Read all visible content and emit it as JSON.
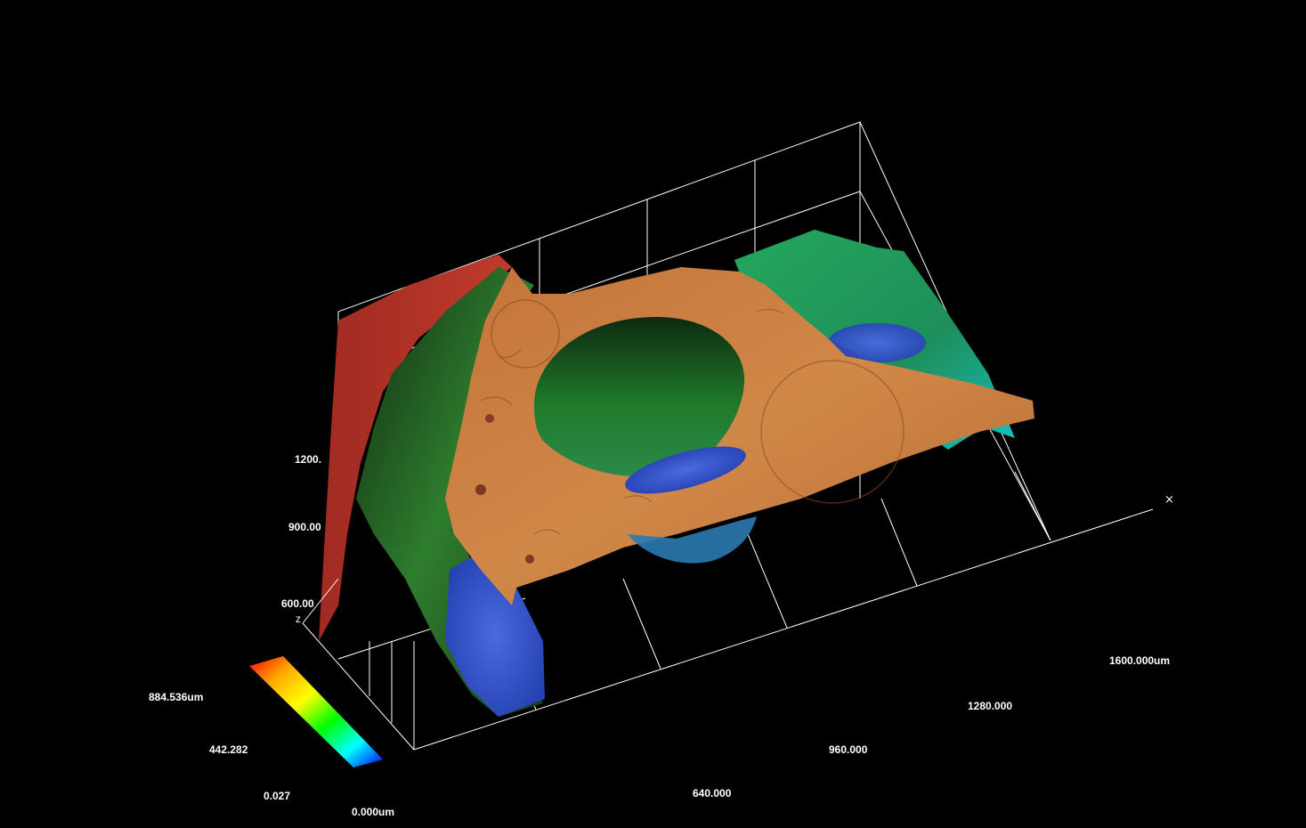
{
  "viewer": {
    "background_color": "#000000",
    "grid_color": "#ffffff",
    "corner_marker": "×",
    "axes": {
      "z_letter": "z",
      "x_ticks": [
        "640.000",
        "960.000",
        "1280.000",
        "1600.000um"
      ],
      "y_ticks": [
        "600.00",
        "900.00",
        "1200."
      ]
    },
    "color_scale": {
      "max_label": "884.536um",
      "mid_label": "442.282",
      "low_label": "0.027",
      "zero_label": "0.000um",
      "gradient_colors": [
        "#ff0000",
        "#ffaa00",
        "#ffff00",
        "#00ff00",
        "#00ffff",
        "#0000ff"
      ]
    },
    "surface_colors": {
      "top_plateau": "#c8763a",
      "left_ridge": "#b8332a",
      "right_ridge": "#2fa36a",
      "pit_mid": "#1f6a32",
      "pit_floor": "#2f55c8"
    }
  }
}
